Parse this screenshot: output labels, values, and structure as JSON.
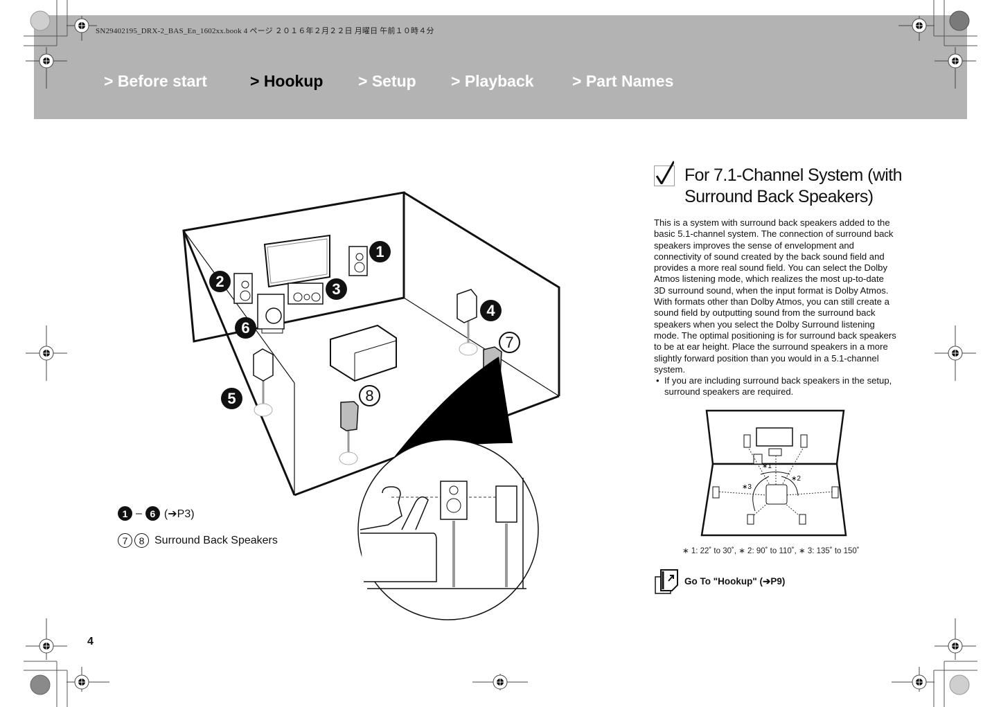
{
  "print_info": "SN29402195_DRX-2_BAS_En_1602xx.book  4 ページ  ２０１６年２月２２日  月曜日  午前１０時４分",
  "nav": {
    "items": [
      {
        "label": "> Before start",
        "active": false
      },
      {
        "label": "> Hookup",
        "active": true
      },
      {
        "label": "> Setup",
        "active": false
      },
      {
        "label": "> Playback",
        "active": false
      },
      {
        "label": "> Part Names",
        "active": false
      }
    ]
  },
  "colors": {
    "header_band": "#b3b3b3",
    "nav_text": "#ffffff",
    "nav_active": "#000000",
    "surround_back_speaker_fill": "#bdbdbd"
  },
  "room_diagram": {
    "callouts": [
      "1",
      "2",
      "3",
      "4",
      "5",
      "6",
      "7",
      "8"
    ]
  },
  "legend": {
    "range_start": "1",
    "range_dash": "–",
    "range_end": "6",
    "range_ref": "(➔P3)",
    "sb_num_a": "7",
    "sb_num_b": "8",
    "sb_label": "Surround Back Speakers"
  },
  "section": {
    "icon": "checkmark-icon",
    "title_line1": "For 7.1-Channel System (with",
    "title_line2": "Surround Back Speakers)",
    "paragraph": "This is a system with surround back speakers added to the basic 5.1-channel system. The connection of surround back speakers improves the sense of envelopment and connectivity of sound created by the back sound field and provides a more real sound field. You can select the Dolby Atmos listening mode, which realizes the most up-to-date 3D surround sound, when the input format is Dolby Atmos. With formats other than Dolby Atmos, you can still create a sound field by outputting sound from the surround back speakers when you select the Dolby Surround listening mode. The optimal positioning is for surround back speakers to be at ear height. Place the surround speakers in a more slightly forward position than you would in a 5.1-channel system.",
    "bullet": "If you are including surround back speakers in the setup, surround speakers are required."
  },
  "angle_diagram": {
    "labels": [
      "∗1",
      "∗2",
      "∗3"
    ],
    "note": "∗ 1: 22˚ to 30˚, ∗ 2: 90˚ to 110˚, ∗ 3: 135˚ to 150˚"
  },
  "goto": {
    "icon": "goto-page-icon",
    "label": "Go To \"Hookup\" (➔P9)"
  },
  "page_number": "4"
}
